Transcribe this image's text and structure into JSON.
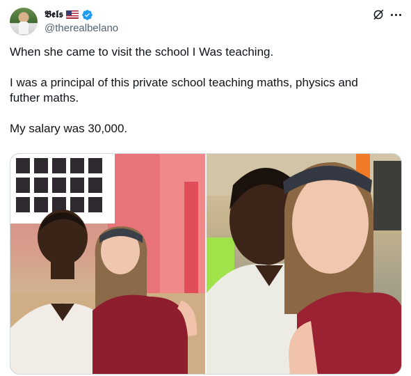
{
  "author": {
    "display_name": "𝕭𝖊𝖑𝖘",
    "handle": "@therealbelano",
    "flag": "US flag emoji",
    "verified": true
  },
  "header_icons": [
    "grok-icon",
    "more-icon"
  ],
  "tweet": {
    "paragraphs": [
      "When she came to visit the school I Was teaching.",
      "I was a principal of this private school teaching maths, physics and\nfuther maths.",
      "My salary was 30,000."
    ]
  },
  "media": {
    "photos": [
      {
        "description": "selfie-left"
      },
      {
        "description": "selfie-right"
      }
    ]
  },
  "colors": {
    "text": "#0f1419",
    "secondary": "#536471",
    "verified": "#1d9bf0",
    "border": "#cfd9de"
  }
}
